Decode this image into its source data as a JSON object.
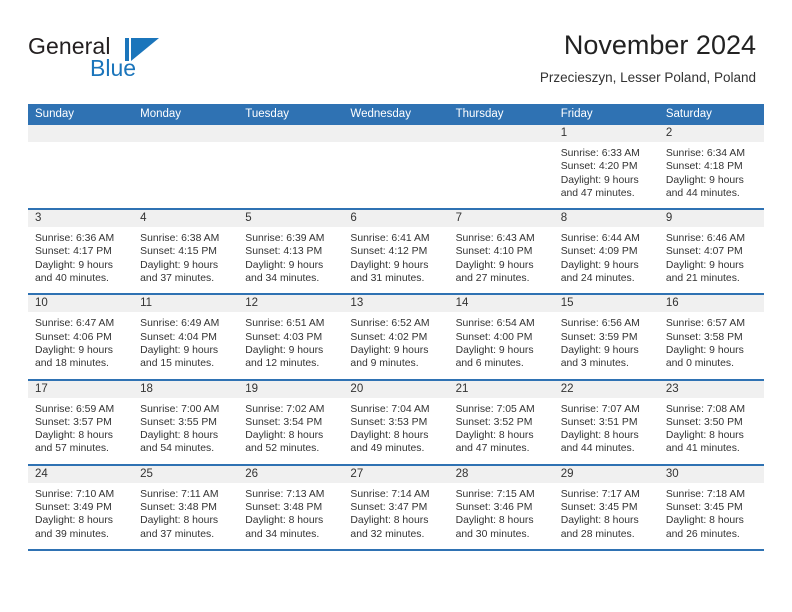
{
  "brand": {
    "name_part1": "General",
    "name_part2": "Blue",
    "mark": "triangle-logo",
    "accent_color": "#1b75bb"
  },
  "header": {
    "title": "November 2024",
    "subtitle": "Przecieszyn, Lesser Poland, Poland"
  },
  "theme": {
    "header_blue": "#2f72b3",
    "date_band_gray": "#f0f0f0",
    "text": "#333333"
  },
  "calendar": {
    "weekdays": [
      "Sunday",
      "Monday",
      "Tuesday",
      "Wednesday",
      "Thursday",
      "Friday",
      "Saturday"
    ],
    "weeks": [
      [
        {
          "day": "",
          "lines": []
        },
        {
          "day": "",
          "lines": []
        },
        {
          "day": "",
          "lines": []
        },
        {
          "day": "",
          "lines": []
        },
        {
          "day": "",
          "lines": []
        },
        {
          "day": "1",
          "lines": [
            "Sunrise: 6:33 AM",
            "Sunset: 4:20 PM",
            "Daylight: 9 hours",
            "and 47 minutes."
          ]
        },
        {
          "day": "2",
          "lines": [
            "Sunrise: 6:34 AM",
            "Sunset: 4:18 PM",
            "Daylight: 9 hours",
            "and 44 minutes."
          ]
        }
      ],
      [
        {
          "day": "3",
          "lines": [
            "Sunrise: 6:36 AM",
            "Sunset: 4:17 PM",
            "Daylight: 9 hours",
            "and 40 minutes."
          ]
        },
        {
          "day": "4",
          "lines": [
            "Sunrise: 6:38 AM",
            "Sunset: 4:15 PM",
            "Daylight: 9 hours",
            "and 37 minutes."
          ]
        },
        {
          "day": "5",
          "lines": [
            "Sunrise: 6:39 AM",
            "Sunset: 4:13 PM",
            "Daylight: 9 hours",
            "and 34 minutes."
          ]
        },
        {
          "day": "6",
          "lines": [
            "Sunrise: 6:41 AM",
            "Sunset: 4:12 PM",
            "Daylight: 9 hours",
            "and 31 minutes."
          ]
        },
        {
          "day": "7",
          "lines": [
            "Sunrise: 6:43 AM",
            "Sunset: 4:10 PM",
            "Daylight: 9 hours",
            "and 27 minutes."
          ]
        },
        {
          "day": "8",
          "lines": [
            "Sunrise: 6:44 AM",
            "Sunset: 4:09 PM",
            "Daylight: 9 hours",
            "and 24 minutes."
          ]
        },
        {
          "day": "9",
          "lines": [
            "Sunrise: 6:46 AM",
            "Sunset: 4:07 PM",
            "Daylight: 9 hours",
            "and 21 minutes."
          ]
        }
      ],
      [
        {
          "day": "10",
          "lines": [
            "Sunrise: 6:47 AM",
            "Sunset: 4:06 PM",
            "Daylight: 9 hours",
            "and 18 minutes."
          ]
        },
        {
          "day": "11",
          "lines": [
            "Sunrise: 6:49 AM",
            "Sunset: 4:04 PM",
            "Daylight: 9 hours",
            "and 15 minutes."
          ]
        },
        {
          "day": "12",
          "lines": [
            "Sunrise: 6:51 AM",
            "Sunset: 4:03 PM",
            "Daylight: 9 hours",
            "and 12 minutes."
          ]
        },
        {
          "day": "13",
          "lines": [
            "Sunrise: 6:52 AM",
            "Sunset: 4:02 PM",
            "Daylight: 9 hours",
            "and 9 minutes."
          ]
        },
        {
          "day": "14",
          "lines": [
            "Sunrise: 6:54 AM",
            "Sunset: 4:00 PM",
            "Daylight: 9 hours",
            "and 6 minutes."
          ]
        },
        {
          "day": "15",
          "lines": [
            "Sunrise: 6:56 AM",
            "Sunset: 3:59 PM",
            "Daylight: 9 hours",
            "and 3 minutes."
          ]
        },
        {
          "day": "16",
          "lines": [
            "Sunrise: 6:57 AM",
            "Sunset: 3:58 PM",
            "Daylight: 9 hours",
            "and 0 minutes."
          ]
        }
      ],
      [
        {
          "day": "17",
          "lines": [
            "Sunrise: 6:59 AM",
            "Sunset: 3:57 PM",
            "Daylight: 8 hours",
            "and 57 minutes."
          ]
        },
        {
          "day": "18",
          "lines": [
            "Sunrise: 7:00 AM",
            "Sunset: 3:55 PM",
            "Daylight: 8 hours",
            "and 54 minutes."
          ]
        },
        {
          "day": "19",
          "lines": [
            "Sunrise: 7:02 AM",
            "Sunset: 3:54 PM",
            "Daylight: 8 hours",
            "and 52 minutes."
          ]
        },
        {
          "day": "20",
          "lines": [
            "Sunrise: 7:04 AM",
            "Sunset: 3:53 PM",
            "Daylight: 8 hours",
            "and 49 minutes."
          ]
        },
        {
          "day": "21",
          "lines": [
            "Sunrise: 7:05 AM",
            "Sunset: 3:52 PM",
            "Daylight: 8 hours",
            "and 47 minutes."
          ]
        },
        {
          "day": "22",
          "lines": [
            "Sunrise: 7:07 AM",
            "Sunset: 3:51 PM",
            "Daylight: 8 hours",
            "and 44 minutes."
          ]
        },
        {
          "day": "23",
          "lines": [
            "Sunrise: 7:08 AM",
            "Sunset: 3:50 PM",
            "Daylight: 8 hours",
            "and 41 minutes."
          ]
        }
      ],
      [
        {
          "day": "24",
          "lines": [
            "Sunrise: 7:10 AM",
            "Sunset: 3:49 PM",
            "Daylight: 8 hours",
            "and 39 minutes."
          ]
        },
        {
          "day": "25",
          "lines": [
            "Sunrise: 7:11 AM",
            "Sunset: 3:48 PM",
            "Daylight: 8 hours",
            "and 37 minutes."
          ]
        },
        {
          "day": "26",
          "lines": [
            "Sunrise: 7:13 AM",
            "Sunset: 3:48 PM",
            "Daylight: 8 hours",
            "and 34 minutes."
          ]
        },
        {
          "day": "27",
          "lines": [
            "Sunrise: 7:14 AM",
            "Sunset: 3:47 PM",
            "Daylight: 8 hours",
            "and 32 minutes."
          ]
        },
        {
          "day": "28",
          "lines": [
            "Sunrise: 7:15 AM",
            "Sunset: 3:46 PM",
            "Daylight: 8 hours",
            "and 30 minutes."
          ]
        },
        {
          "day": "29",
          "lines": [
            "Sunrise: 7:17 AM",
            "Sunset: 3:45 PM",
            "Daylight: 8 hours",
            "and 28 minutes."
          ]
        },
        {
          "day": "30",
          "lines": [
            "Sunrise: 7:18 AM",
            "Sunset: 3:45 PM",
            "Daylight: 8 hours",
            "and 26 minutes."
          ]
        }
      ]
    ]
  }
}
